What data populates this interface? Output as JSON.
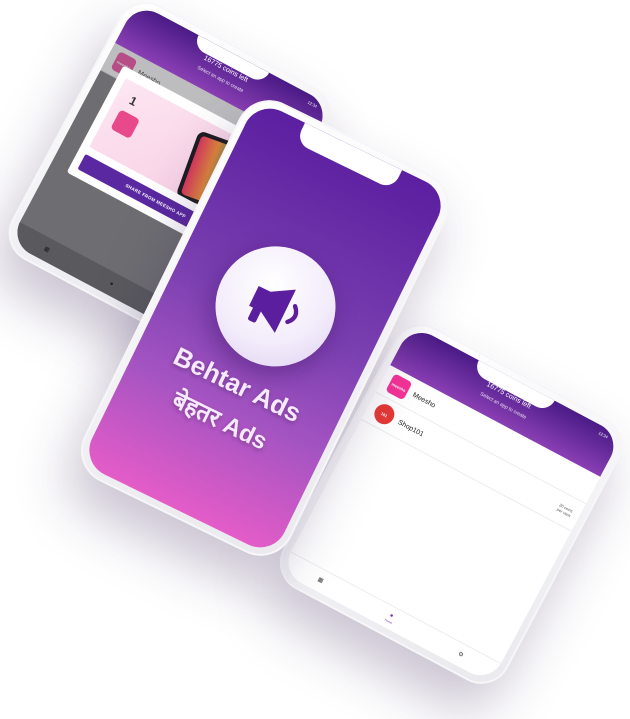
{
  "hero": {
    "title": "Behtar Ads",
    "subtitle": "बेहतर Ads",
    "icon": "megaphone-icon",
    "colors": {
      "gradient_top": "#5b1fa0",
      "gradient_bottom": "#e45cc8",
      "accent": "#7b2fb5"
    }
  },
  "app": {
    "coins_text": "16775 coins left",
    "subtitle": "Select an app to create",
    "time": "12:34",
    "apps": [
      {
        "name": "Meesho",
        "logo_text": "meesho",
        "logo_color": "#f43397",
        "meta_line1": "",
        "meta_line2": ""
      },
      {
        "name": "Shop101",
        "logo_text": "101",
        "logo_color": "#e53935",
        "meta_line1": "20 coins",
        "meta_line2": "per view"
      }
    ],
    "tabs": [
      {
        "icon": "grid-icon",
        "label": ""
      },
      {
        "icon": "home-icon",
        "label": "Home"
      },
      {
        "icon": "settings-icon",
        "label": ""
      }
    ]
  },
  "modal": {
    "step": "1",
    "button_label": "SHARE FROM MEESHO APP"
  }
}
